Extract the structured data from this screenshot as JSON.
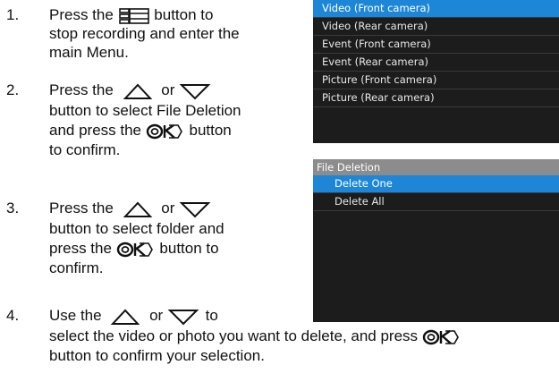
{
  "steps": [
    {
      "number": "1.",
      "lines": [
        "Press the",
        "button to",
        "stop recording and enter the",
        "main Menu."
      ]
    },
    {
      "number": "2.",
      "lines": [
        "Press the",
        "or",
        "button to select File Deletion",
        "and press the",
        "button",
        "to confirm."
      ]
    },
    {
      "number": "3.",
      "lines": [
        "Press the",
        "or",
        "button to select folder and",
        "press the",
        "button to",
        "confirm."
      ]
    },
    {
      "number": "4.",
      "lines": [
        "Use the",
        "or",
        "to",
        "select the video or photo you want to delete, and press",
        "button to confirm your selection."
      ]
    }
  ],
  "icons": {
    "menu": "menu-icon",
    "up": "up-triangle-icon",
    "down": "down-triangle-icon",
    "ok": "ok-button-icon"
  },
  "screen_top": {
    "items": [
      "Video (Front camera)",
      "Video (Rear camera)",
      "Event (Front camera)",
      "Event (Rear camera)",
      "Picture (Front camera)",
      "Picture (Rear camera)"
    ],
    "selected_index": 0
  },
  "screen_bottom": {
    "header": "File Deletion",
    "items": [
      "Delete One",
      "Delete All"
    ],
    "selected_index": 0
  },
  "colors": {
    "selected": "#1e86d7",
    "screen_bg": "#1c1c1c",
    "header_bg": "#8c8c8c"
  }
}
